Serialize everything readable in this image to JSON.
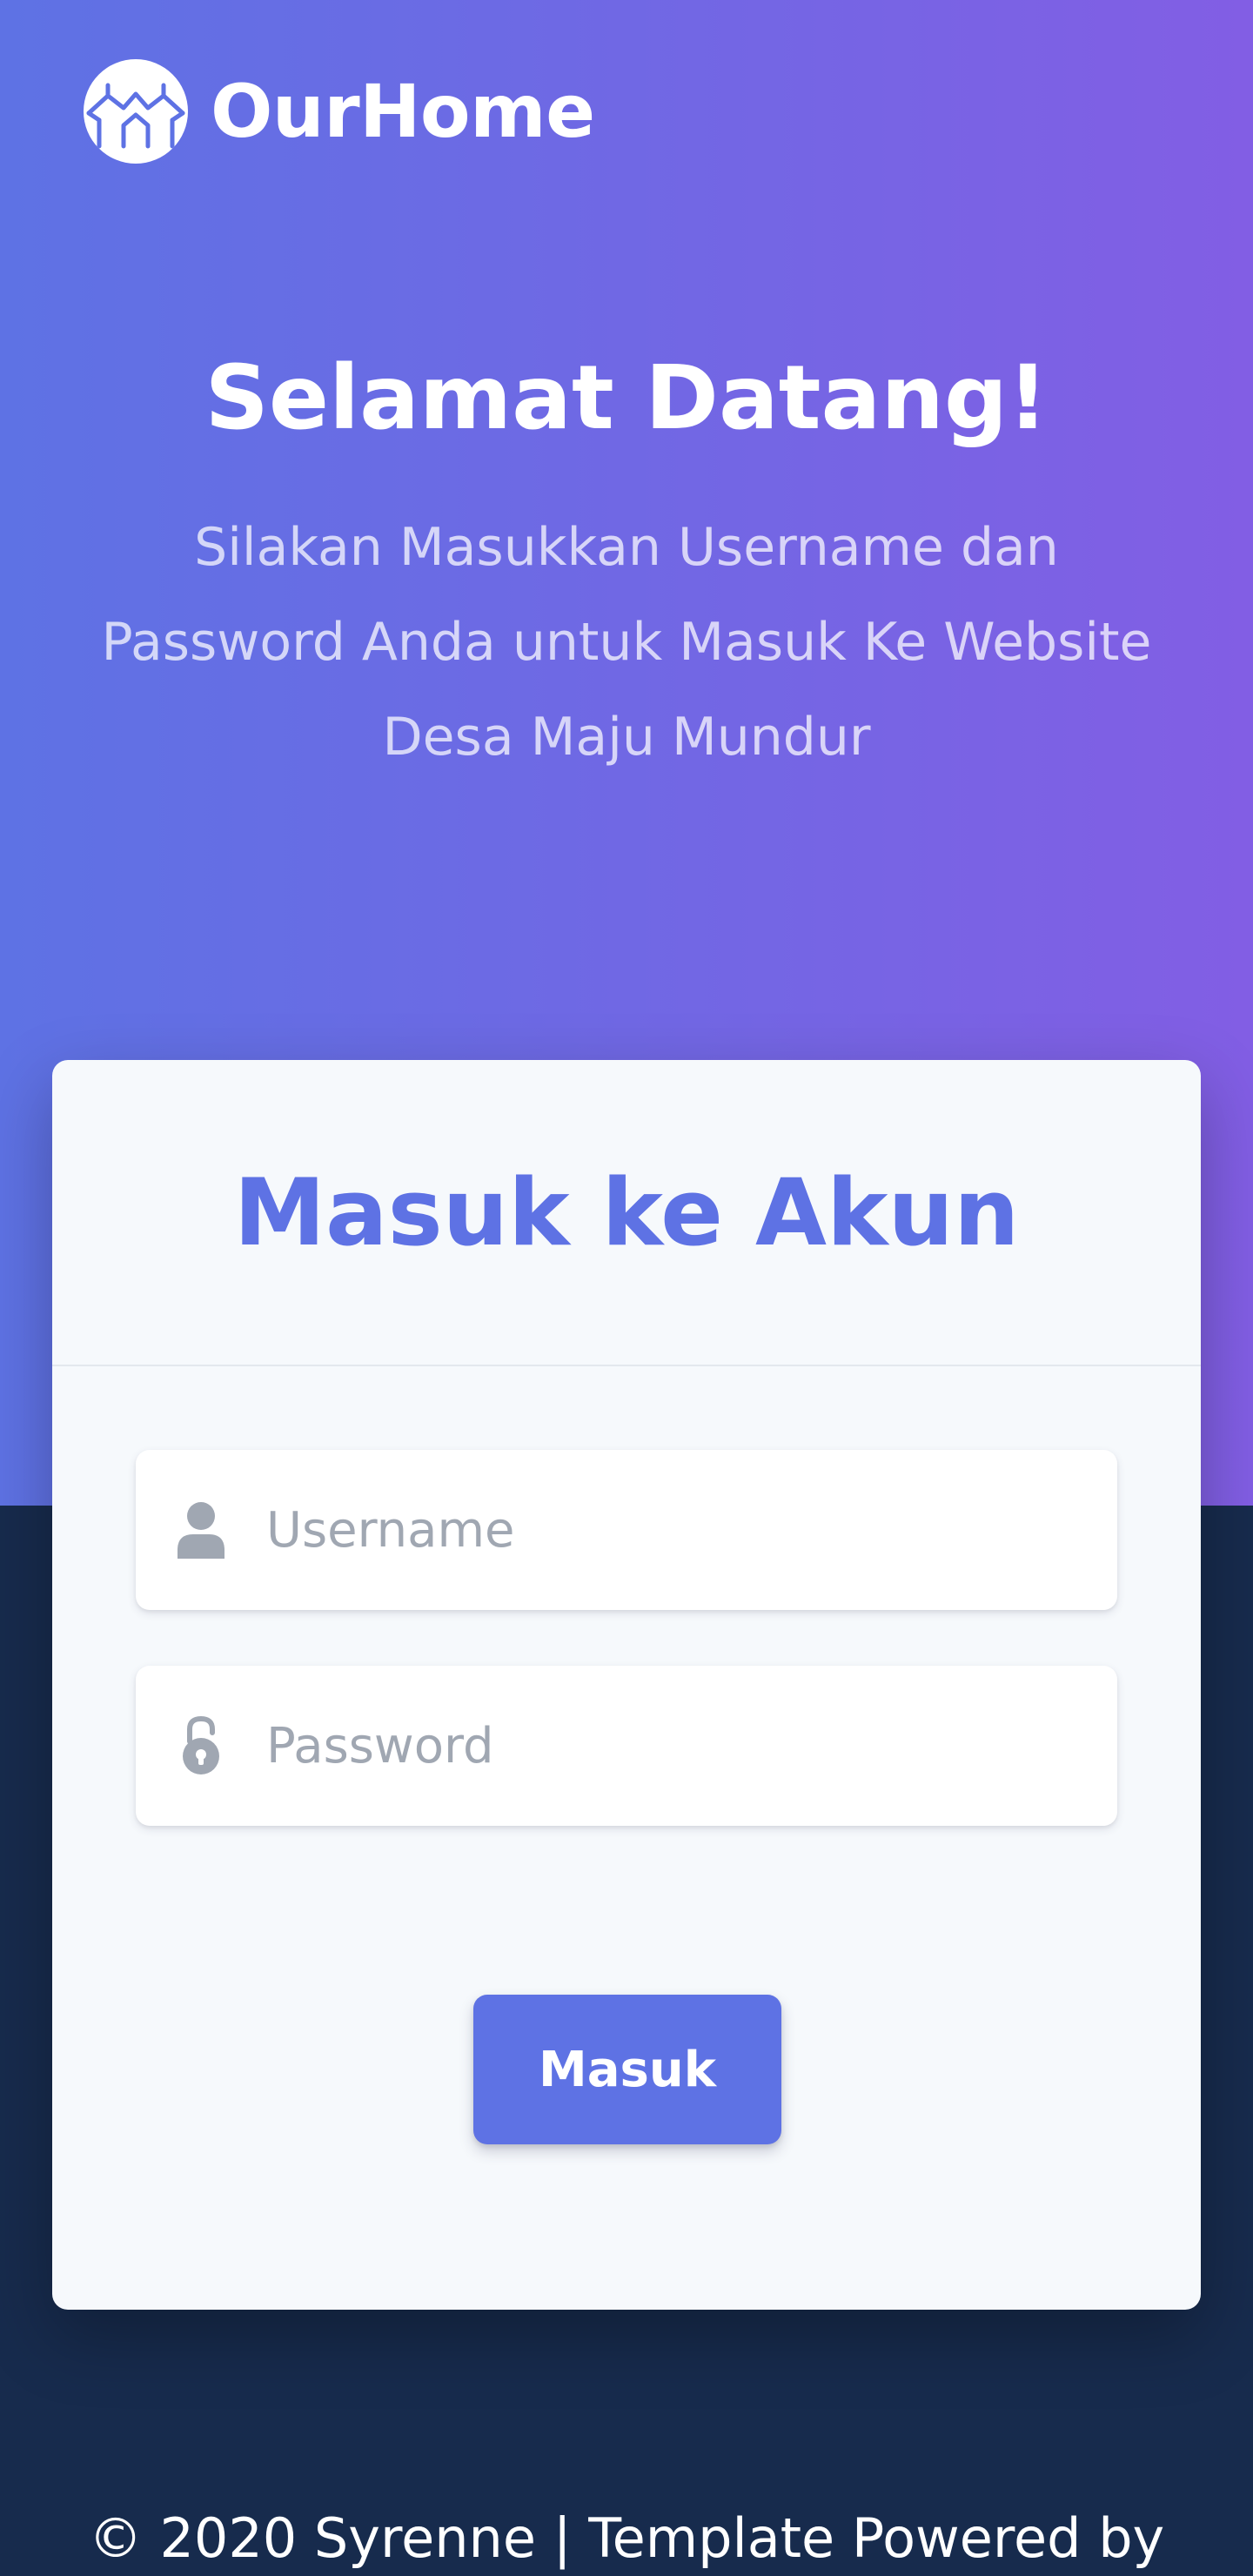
{
  "brand": {
    "name": "OurHome",
    "logo_icon": "house-network-icon"
  },
  "hero": {
    "title": "Selamat Datang!",
    "subtitle": "Silakan Masukkan Username dan Password Anda untuk Masuk Ke Website Desa Maju Mundur"
  },
  "login": {
    "title": "Masuk ke Akun",
    "username": {
      "placeholder": "Username",
      "value": "",
      "icon": "user-icon"
    },
    "password": {
      "placeholder": "Password",
      "value": "",
      "icon": "unlock-icon"
    },
    "submit_label": "Masuk"
  },
  "footer": {
    "text": "© 2020 Syrenne | Template Powered by"
  },
  "colors": {
    "primary": "#5e72e4",
    "gradient_end": "#825ee4",
    "dark_background": "#172b4d",
    "card_background": "#f6f9fc",
    "icon_gray": "#a0a7b2"
  }
}
